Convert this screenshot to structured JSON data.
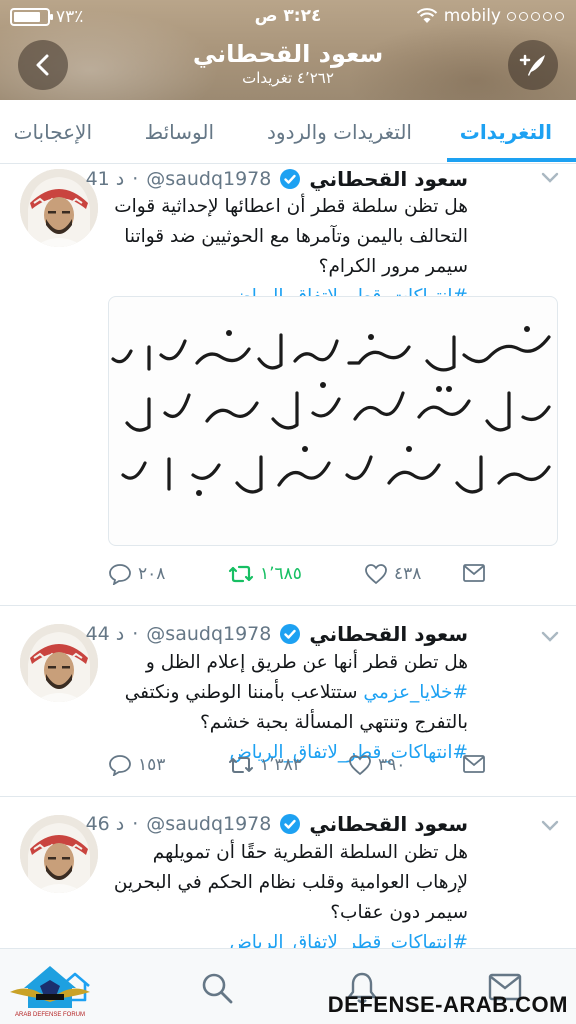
{
  "status_bar": {
    "battery": "٧٣٪",
    "time": "٣:٢٤ ص",
    "carrier": "mobily"
  },
  "header": {
    "profile_name": "سعود القحطاني",
    "tweet_count": "٤٬٢٦٢ تغريدات",
    "back_icon": "chevron-left-icon",
    "compose_icon": "compose-icon"
  },
  "tabs": [
    {
      "label": "التغريدات",
      "active": true
    },
    {
      "label": "التغريدات والردود",
      "active": false
    },
    {
      "label": "الوسائط",
      "active": false
    },
    {
      "label": "الإعجابات",
      "active": false
    }
  ],
  "tweets": [
    {
      "name": "سعود القحطاني",
      "handle": "@saudq1978",
      "time": "41 د",
      "text_plain": "هل تظن سلطة قطر أن اعطائها لإحداثية قوات التحالف باليمن وتآمرها مع الحوثيين ضد قواتنا  سيمر مرور الكرام؟ ",
      "hashtag": "#انتهاكات_قطر_لاتفاق_الرياض",
      "replies": "٢٠٨",
      "retweets": "١٬٦٨٥",
      "likes": "٤٣٨"
    },
    {
      "name": "سعود القحطاني",
      "handle": "@saudq1978",
      "time": "44 د",
      "text_before": "هل تطن قطر أنها عن طريق إعلام الظل و ",
      "hashtag_inline": "#خلايا_عزمي",
      "text_after": " ستتلاعب بأمننا الوطني ونكتفي بالتفرج وتنتهي المسألة بحبة خشم؟ ",
      "hashtag": "#انتهاكات_قطر_لاتفاق_الرياض",
      "replies": "١٥٣",
      "retweets": "١٬٣٨٣",
      "likes": "٣٩٠"
    },
    {
      "name": "سعود القحطاني",
      "handle": "@saudq1978",
      "time": "46 د",
      "text_plain": "هل تظن السلطة القطرية حقًا أن تمويلهم لإرهاب العوامية وقلب نظام الحكم في البحرين سيمر دون عقاب؟ ",
      "hashtag": "#انتهاكات_قطر_لاتفاق_الرياض"
    }
  ],
  "watermark": {
    "site": "DEFENSE-ARAB.COM",
    "logo_text": "ARAB DEFENSE FORUM"
  },
  "colors": {
    "accent": "#1da1f2",
    "retweet_active": "#17bf63",
    "muted": "#657786"
  }
}
